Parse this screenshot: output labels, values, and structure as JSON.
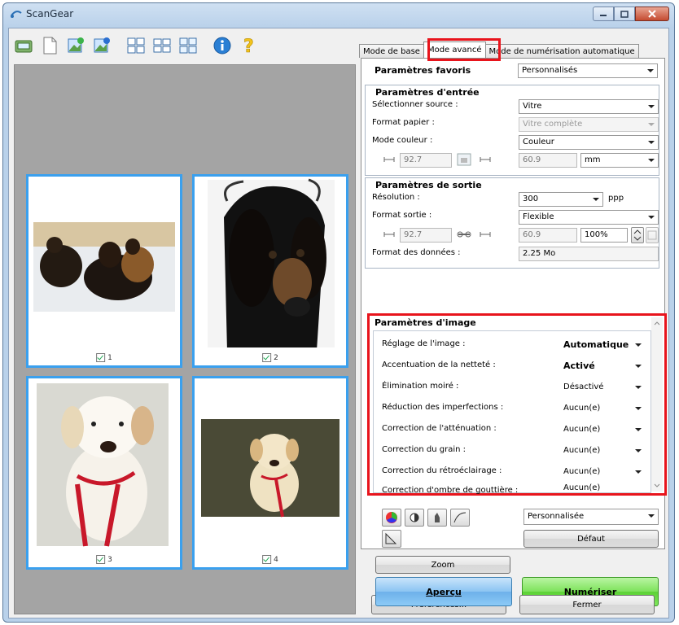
{
  "window": {
    "title": "ScanGear"
  },
  "toolbar": {
    "buttons": [
      "scanner-icon",
      "blank-page-icon",
      "add-image-icon",
      "remove-image-icon",
      "thumbnail-grid-icon",
      "thumbnail-list-icon",
      "thumbnail-large-icon",
      "info-icon",
      "help-icon"
    ]
  },
  "thumbnails": [
    {
      "label": "1",
      "checked": true
    },
    {
      "label": "2",
      "checked": true
    },
    {
      "label": "3",
      "checked": true
    },
    {
      "label": "4",
      "checked": true
    }
  ],
  "tabs": {
    "basic": "Mode de base",
    "advanced": "Mode avancé",
    "auto": "Mode de numérisation automatique"
  },
  "favorites": {
    "label": "Paramètres favoris",
    "value": "Personnalisés"
  },
  "input": {
    "title": "Paramètres d'entrée",
    "source_label": "Sélectionner source :",
    "source_value": "Vitre",
    "paper_label": "Format papier :",
    "paper_value": "Vitre complète",
    "color_label": "Mode couleur :",
    "color_value": "Couleur",
    "width": "92.7",
    "height": "60.9",
    "unit": "mm"
  },
  "output": {
    "title": "Paramètres de sortie",
    "resolution_label": "Résolution :",
    "resolution_value": "300",
    "resolution_unit": "ppp",
    "size_label": "Format sortie :",
    "size_value": "Flexible",
    "width": "92.7",
    "height": "60.9",
    "scale": "100%",
    "datasize_label": "Format des données :",
    "datasize_value": "2.25 Mo"
  },
  "image_settings": {
    "title": "Paramètres d'image",
    "rows": [
      {
        "label": "Réglage de l'image :",
        "value": "Automatique",
        "bold": true
      },
      {
        "label": "Accentuation de la netteté :",
        "value": "Activé",
        "bold": true
      },
      {
        "label": "Élimination moiré :",
        "value": "Désactivé",
        "bold": false
      },
      {
        "label": "Réduction des imperfections :",
        "value": "Aucun(e)",
        "bold": false
      },
      {
        "label": "Correction de l'atténuation :",
        "value": "Aucun(e)",
        "bold": false
      },
      {
        "label": "Correction du grain :",
        "value": "Aucun(e)",
        "bold": false
      },
      {
        "label": "Correction du rétroéclairage :",
        "value": "Aucun(e)",
        "bold": false
      },
      {
        "label": "Correction d'ombre de gouttière :",
        "value": "Aucun(e)",
        "bold": false
      }
    ]
  },
  "color_adjust": {
    "preset": "Personnalisée",
    "default_label": "Défaut"
  },
  "buttons": {
    "zoom": "Zoom",
    "preview": "Aperçu",
    "scan": "Numériser",
    "preferences": "Préférences...",
    "close": "Fermer"
  },
  "colors": {
    "accent_blue": "#3aa0ee",
    "highlight_red": "#e8141c",
    "scan_green": "#5cd135",
    "preview_blue": "#6db0ea"
  }
}
